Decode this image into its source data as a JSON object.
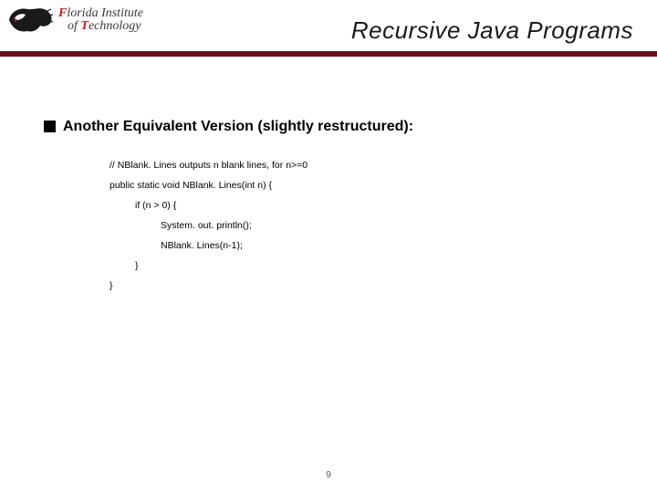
{
  "header": {
    "logo": {
      "line1_colored": "F",
      "line1_rest": "lorida Institute",
      "line2_rest": "of ",
      "line2_colored": "T",
      "line2_rest2": "echnology"
    },
    "title": "Recursive Java Programs"
  },
  "content": {
    "bullet": "Another Equivalent Version (slightly restructured):",
    "code": {
      "l1": "// NBlank. Lines outputs n blank lines, for n>=0",
      "l2": "public static void NBlank. Lines(int n) {",
      "l3": "if (n > 0) {",
      "l4": "System. out. println();",
      "l5": "NBlank. Lines(n-1);",
      "l6": "}",
      "l7": "}"
    }
  },
  "page_number": "9"
}
